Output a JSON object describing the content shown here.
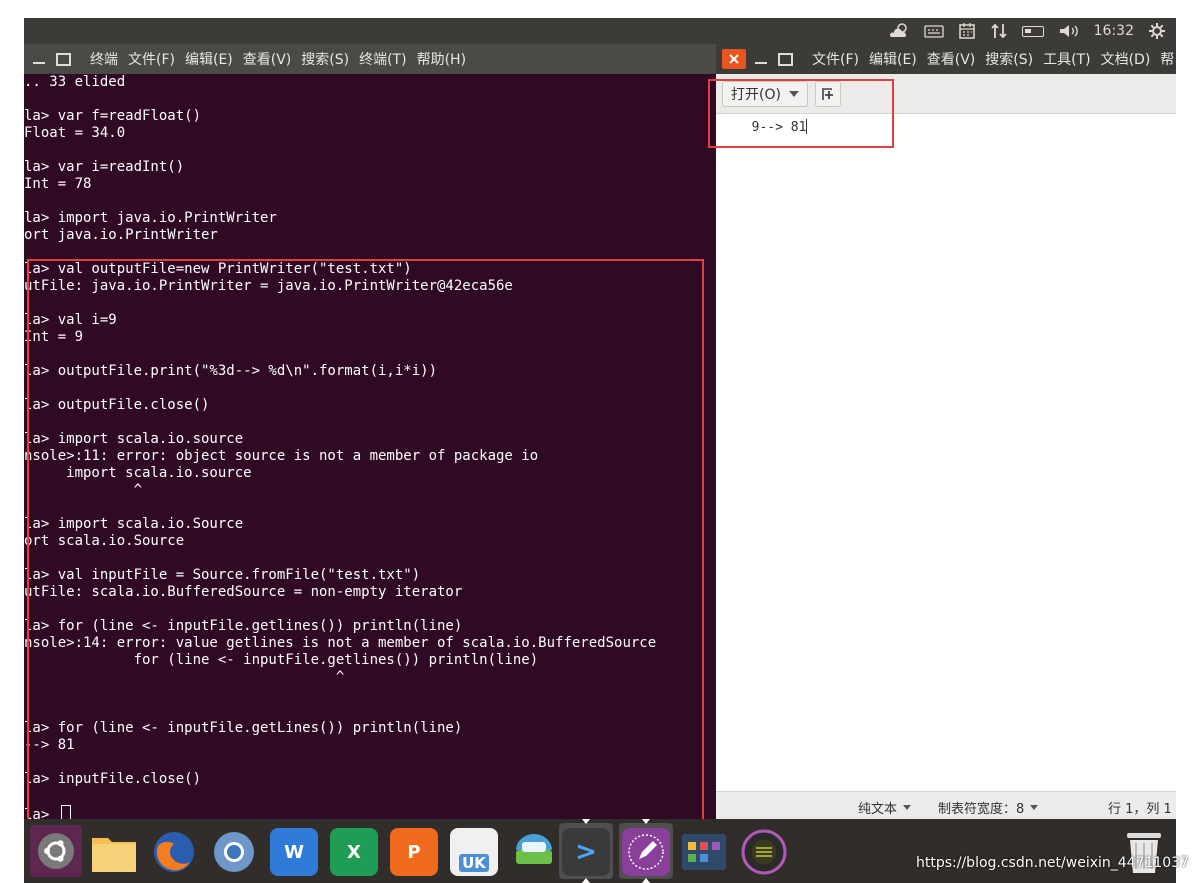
{
  "top_panel": {
    "clock": "16:32",
    "tray_icons": [
      "weather-icon",
      "keyboard-icon",
      "calendar-icon",
      "network-arrows-icon",
      "battery-icon",
      "volume-icon",
      "power-gear-icon"
    ]
  },
  "terminal": {
    "menu": [
      "终端",
      "文件(F)",
      "编辑(E)",
      "查看(V)",
      "搜索(S)",
      "终端(T)",
      "帮助(H)"
    ],
    "lines": [
      ".. 33 elided",
      "",
      "la> var f=readFloat()",
      "Float = 34.0",
      "",
      "la> var i=readInt()",
      "Int = 78",
      "",
      "la> import java.io.PrintWriter",
      "ort java.io.PrintWriter",
      "",
      "la> val outputFile=new PrintWriter(\"test.txt\")",
      "utFile: java.io.PrintWriter = java.io.PrintWriter@42eca56e",
      "",
      "la> val i=9",
      "Int = 9",
      "",
      "la> outputFile.print(\"%3d--> %d\\n\".format(i,i*i))",
      "",
      "la> outputFile.close()",
      "",
      "la> import scala.io.source",
      "nsole>:11: error: object source is not a member of package io",
      "     import scala.io.source",
      "             ^",
      "",
      "la> import scala.io.Source",
      "ort scala.io.Source",
      "",
      "la> val inputFile = Source.fromFile(\"test.txt\")",
      "utFile: scala.io.BufferedSource = non-empty iterator",
      "",
      "la> for (line <- inputFile.getlines()) println(line)",
      "nsole>:14: error: value getlines is not a member of scala.io.BufferedSource",
      "             for (line <- inputFile.getlines()) println(line)",
      "                                     ^",
      "",
      "",
      "la> for (line <- inputFile.getLines()) println(line)",
      "--> 81",
      "",
      "la> inputFile.close()",
      "",
      "la> "
    ]
  },
  "gedit": {
    "menu": [
      "文件(F)",
      "编辑(E)",
      "查看(V)",
      "搜索(S)",
      "工具(T)",
      "文档(D)",
      "帮"
    ],
    "open_label": "打开(O)",
    "content": "  9--> 81",
    "status": {
      "mode": "纯文本",
      "tab_width": "制表符宽度：8",
      "position": "行 1，列 1"
    }
  },
  "dock": {
    "icons": [
      "ubuntu-dash-icon",
      "files-icon",
      "firefox-icon",
      "chromium-icon",
      "wps-writer-icon",
      "wps-spreadsheet-icon",
      "wps-presentation-icon",
      "ubuntu-kylin-store-icon",
      "software-updater-icon",
      "terminal-icon",
      "gedit-icon",
      "workspace-switcher-icon",
      "dvd-icon",
      "trash-icon"
    ],
    "labels": {
      "writer": "W",
      "spreadsheet": "X",
      "presentation": "P",
      "store": "UK",
      "terminal": ">"
    }
  },
  "watermark": "https://blog.csdn.net/weixin_44711037",
  "colors": {
    "terminal_bg": "#300a24",
    "panel_bg": "#3c3b37",
    "accent": "#e95420",
    "highlight_box": "#e04040"
  }
}
